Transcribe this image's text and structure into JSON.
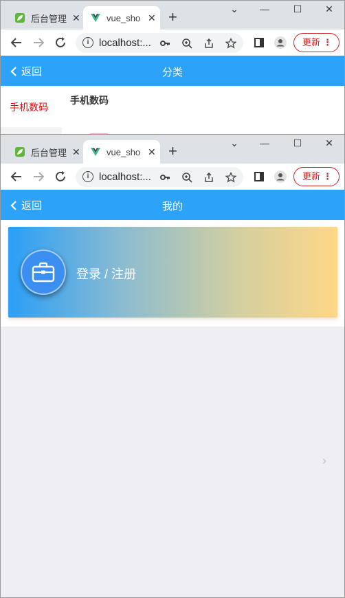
{
  "window1": {
    "tabs": [
      {
        "title": "后台管理",
        "close": "✕"
      },
      {
        "title": "vue_sho",
        "close": "✕"
      }
    ],
    "new_tab": "+",
    "window_controls": {
      "minimize": "⌄",
      "restore": "—",
      "maximize": "☐",
      "close": "✕"
    },
    "url": "localhost:...",
    "update_label": "更新",
    "menu_dots": "⋮",
    "appbar": {
      "back_label": "返回",
      "title": "分类"
    },
    "category": {
      "side_item": "手机数码",
      "main_title": "手机数码"
    }
  },
  "window2": {
    "tabs": [
      {
        "title": "后台管理",
        "close": "✕"
      },
      {
        "title": "vue_sho",
        "close": "✕"
      }
    ],
    "new_tab": "+",
    "window_controls": {
      "minimize": "⌄",
      "restore": "—",
      "maximize": "☐",
      "close": "✕"
    },
    "url": "localhost:...",
    "update_label": "更新",
    "menu_dots": "⋮",
    "appbar": {
      "back_label": "返回",
      "title": "我的"
    },
    "profile": {
      "login_label": "登录 / 注册",
      "arrow": "›"
    }
  },
  "colors": {
    "appbar": "#2ca2f9",
    "active_category": "#ee0000",
    "update_button": "#c5221f",
    "card_gradient_start": "#2b9ff8",
    "card_gradient_end": "#ffd787"
  }
}
